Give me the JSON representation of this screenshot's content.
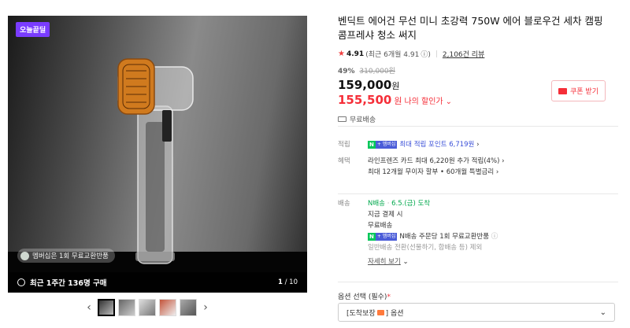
{
  "gallery": {
    "today_badge": "오늘끝딜",
    "membership_text": "멤버십은 1회 무료교환반품",
    "recent_buy_text": "최근 1주간 136명 구매",
    "pager_current": "1",
    "pager_total": "/ 10",
    "prev_arrow": "‹",
    "next_arrow": "›"
  },
  "product": {
    "title": "벤딕트 에어건 무선 미니 초강력 750W 에어 블로우건 세차 캠핑 콤프레샤 청소 써지",
    "rating_star": "★",
    "rating": "4.91",
    "rating_recent": "(최근 6개월 4.91",
    "rating_info_icon": "ⓘ)",
    "reviews": "2,106건 리뷰",
    "discount_rate": "49%",
    "original_price": "310,000원",
    "price": "159,000",
    "price_unit": "원",
    "my_price": "155,500",
    "my_price_unit": "원",
    "my_price_label": "나의 할인가",
    "my_price_chevron": "⌄",
    "coupon_label": "쿠폰 받기",
    "free_shipping": "무료배송"
  },
  "benefits": {
    "points_key": "적립",
    "npay_n": "N",
    "npay_plus": "+ 멤버십",
    "points_text": "최대 적립 포인트 6,719원",
    "points_chevron": "›",
    "card_key": "혜택",
    "card_line1": "라인프렌즈 카드 최대 6,220원 추가 적립(4%)",
    "card_chevron": "›",
    "card_line2": "최대 12개월 무이자 할부 • 60개월 특별금리",
    "card_line2_chevron": "›"
  },
  "delivery": {
    "key": "배송",
    "badge": "N배송",
    "arrival": "6.5.(금) 도착",
    "line_order": "지금 결제 시",
    "line_free": "무료배송",
    "npay_n": "N",
    "npay_plus": "+ 멤버십",
    "exchange": "N배송 주문당 1회 무료교환반품",
    "exchange_info": "ⓘ",
    "general": "일반배송 전환(선물하기, 합배송 등) 제외",
    "more": "자세히 보기",
    "more_chevron": "⌄"
  },
  "options": {
    "label": "옵션 선택 (필수)",
    "required_mark": "*",
    "select_prefix": "[도착보장",
    "select_suffix": "] 옵션",
    "chevron": "⌄"
  },
  "colors": {
    "accent_red": "#f52e38",
    "npay_green": "#03c75a",
    "membership_blue": "#3a4fd8",
    "today_purple": "#7a3cff"
  }
}
